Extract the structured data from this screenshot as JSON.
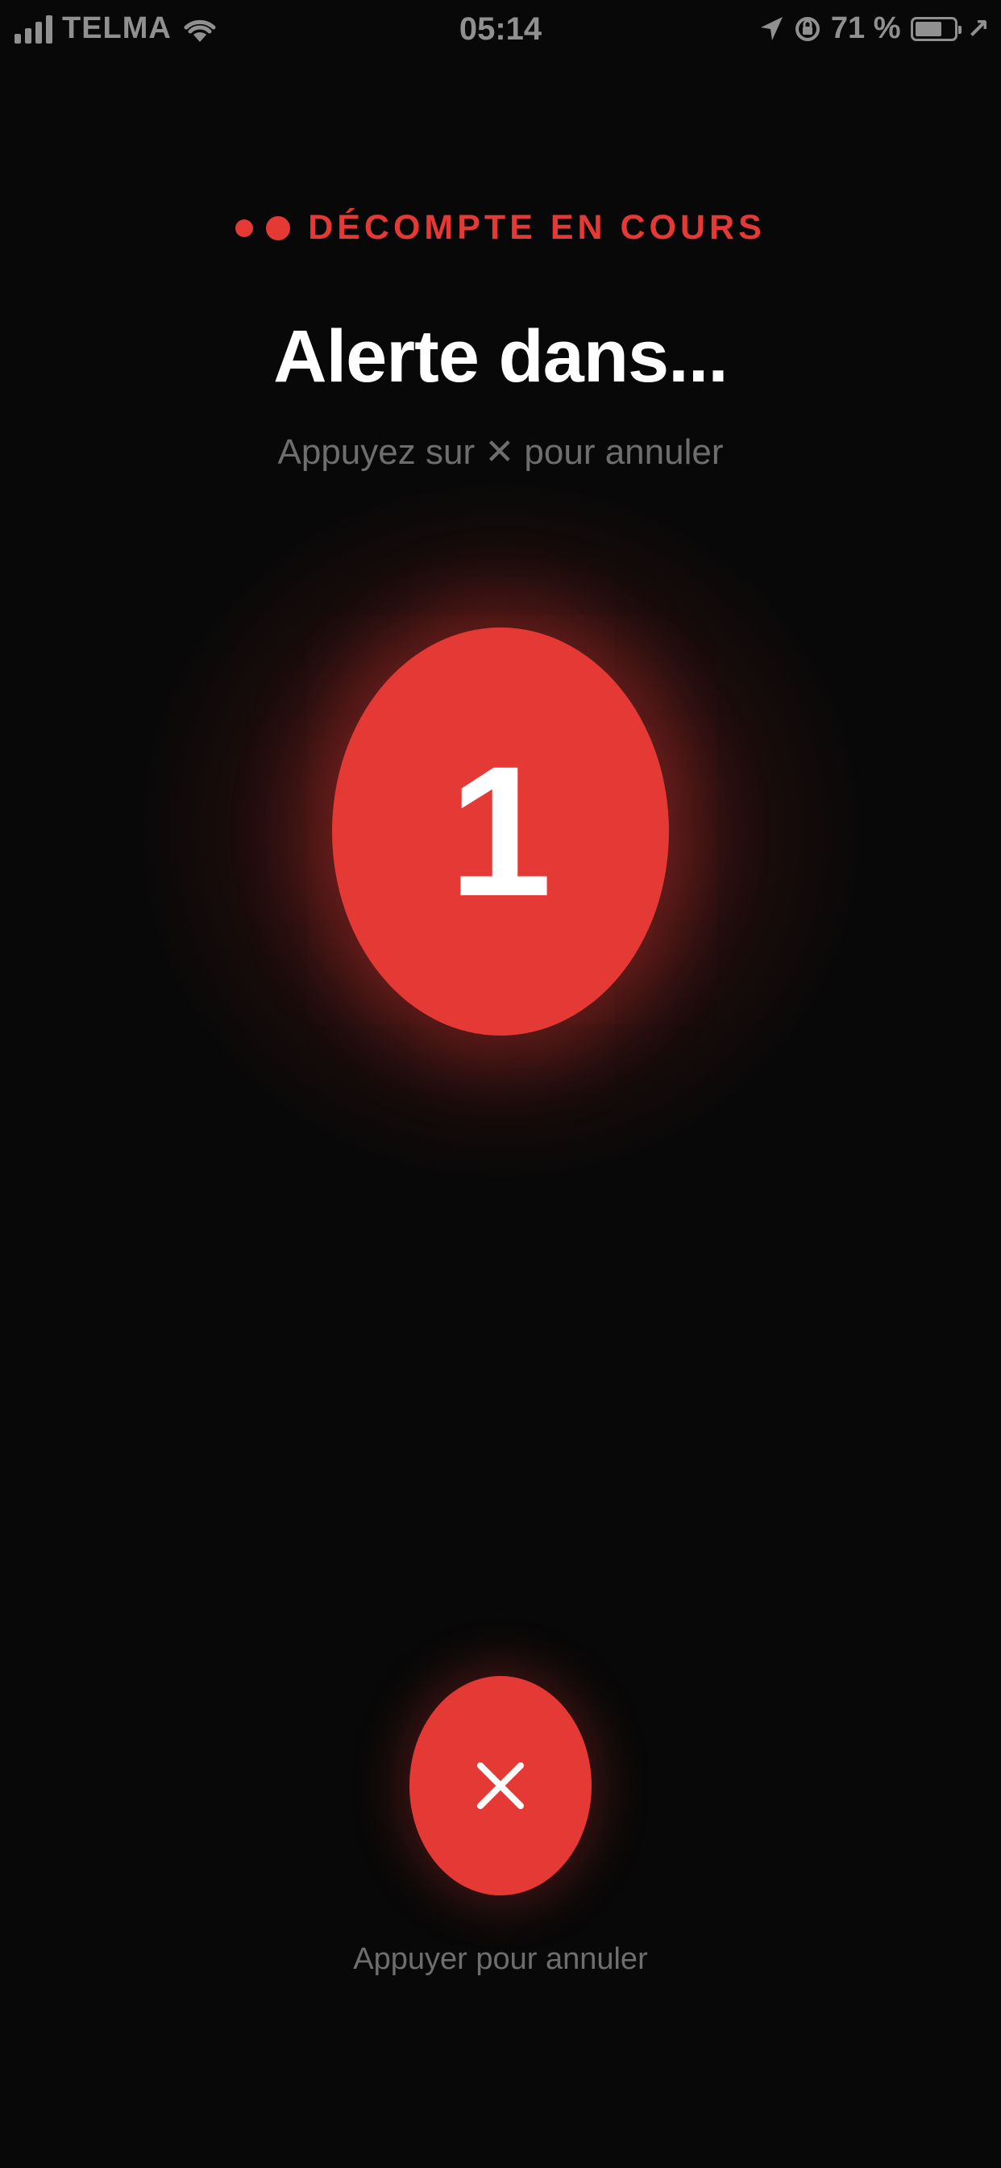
{
  "status_bar": {
    "carrier": "TELMA",
    "time": "05:14",
    "battery_percent": "71 %",
    "extra": "↗"
  },
  "header": {
    "countdown_label": "DÉCOMPTE EN COURS",
    "title": "Alerte dans...",
    "subtitle": "Appuyez sur ✕ pour annuler"
  },
  "countdown": {
    "value": "1"
  },
  "cancel": {
    "label": "Appuyer pour annuler",
    "icon": "close-icon"
  },
  "colors": {
    "accent": "#e53935",
    "background": "#080808",
    "muted_text": "#6e6e6e"
  }
}
